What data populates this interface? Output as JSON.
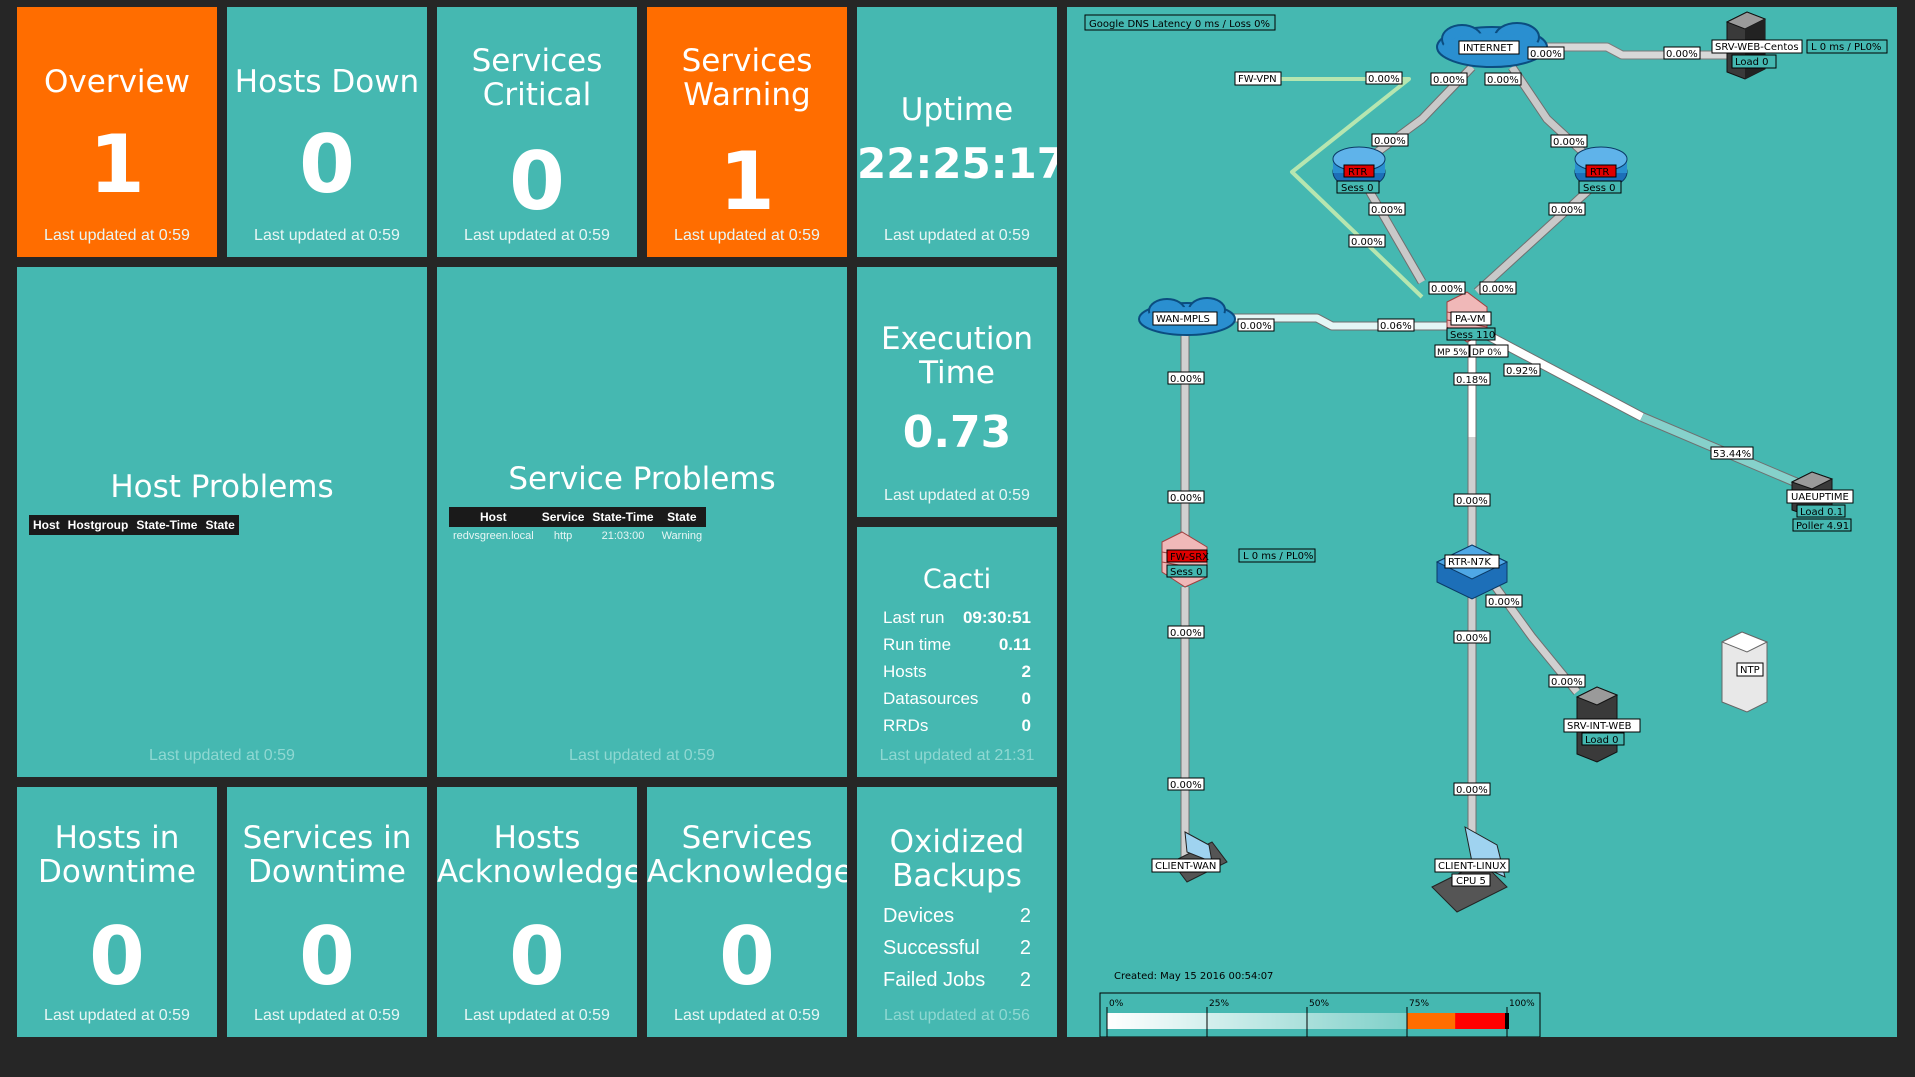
{
  "tiles": {
    "overview": {
      "title": "Overview",
      "value": "1",
      "updated": "Last updated at 0:59"
    },
    "hosts_down": {
      "title": "Hosts Down",
      "value": "0",
      "updated": "Last updated at 0:59"
    },
    "services_critical": {
      "title1": "Services",
      "title2": "Critical",
      "value": "0",
      "updated": "Last updated at 0:59"
    },
    "services_warning": {
      "title1": "Services",
      "title2": "Warning",
      "value": "1",
      "updated": "Last updated at 0:59"
    },
    "uptime": {
      "title": "Uptime",
      "value": "22:25:17",
      "updated": "Last updated at 0:59"
    },
    "host_problems": {
      "title": "Host Problems",
      "headers": [
        "Host",
        "Hostgroup",
        "State-Time",
        "State"
      ],
      "updated": "Last updated at 0:59"
    },
    "service_problems": {
      "title": "Service Problems",
      "headers": [
        "Host",
        "Service",
        "State-Time",
        "State"
      ],
      "rows": [
        [
          "redvsgreen.local",
          "http",
          "21:03:00",
          "Warning"
        ]
      ],
      "updated": "Last updated at 0:59"
    },
    "execution_time": {
      "title1": "Execution",
      "title2": "Time",
      "value": "0.73",
      "updated": "Last updated at 0:59"
    },
    "cacti": {
      "title": "Cacti",
      "rows": [
        [
          "Last run",
          "09:30:51"
        ],
        [
          "Run time",
          "0.11"
        ],
        [
          "Hosts",
          "2"
        ],
        [
          "Datasources",
          "0"
        ],
        [
          "RRDs",
          "0"
        ]
      ],
      "updated": "Last updated at 21:31"
    },
    "hosts_in_downtime": {
      "title1": "Hosts in",
      "title2": "Downtime",
      "value": "0",
      "updated": "Last updated at 0:59"
    },
    "services_in_downtime": {
      "title1": "Services in",
      "title2": "Downtime",
      "value": "0",
      "updated": "Last updated at 0:59"
    },
    "hosts_acknowledged": {
      "title1": "Hosts",
      "title2": "Acknowledged",
      "value": "0",
      "updated": "Last updated at 0:59"
    },
    "services_acknowledged": {
      "title1": "Services",
      "title2": "Acknowledged",
      "value": "0",
      "updated": "Last updated at 0:59"
    },
    "oxidized": {
      "title1": "Oxidized",
      "title2": "Backups",
      "rows": [
        [
          "Devices",
          "2"
        ],
        [
          "Successful",
          "2"
        ],
        [
          "Failed Jobs",
          "2"
        ]
      ],
      "updated": "Last updated at 0:56"
    }
  },
  "weathermap": {
    "title_box": "Google DNS Latency 0 ms / Loss 0%",
    "created": "Created: May 15 2016 00:54:07",
    "nodes": {
      "internet": "INTERNET",
      "srv_web_centos": "SRV-WEB-Centos",
      "srv_web_centos_load": "Load 0",
      "srv_web_centos_latency": "L 0 ms / PL0%",
      "fw_vpn": "FW-VPN",
      "rtr1": "RTR",
      "rtr1_sess": "Sess 0",
      "rtr2": "RTR",
      "rtr2_sess": "Sess 0",
      "wan_mpls": "WAN-MPLS",
      "pa_vm": "PA-VM",
      "pa_vm_sess": "Sess 110",
      "pa_vm_mp": "MP 5%",
      "pa_vm_dp": "DP 0%",
      "uaeuptime": "UAEUPTIME",
      "uaeuptime_load": "Load 0.1",
      "uaeuptime_poller": "Poller 4.91",
      "fw_srx": "FW-SRX",
      "fw_srx_sess": "Sess 0",
      "fw_srx_latency": "L 0 ms / PL0%",
      "rtr_n7k": "RTR-N7K",
      "srv_int_web": "SRV-INT-WEB",
      "srv_int_web_load": "Load 0",
      "ntp": "NTP",
      "client_wan": "CLIENT-WAN",
      "client_linux": "CLIENT-LINUX",
      "client_linux_cpu": "CPU 5"
    },
    "link_labels": {
      "inet_centos_a": "0.00%",
      "inet_centos_b": "0.00%",
      "vpn": "0.00%",
      "inet_rtr1_a": "0.00%",
      "inet_rtr1_b": "0.00%",
      "inet_rtr2_a": "0.00%",
      "inet_rtr2_b": "0.00%",
      "rtr1_pa_a": "0.00%",
      "rtr1_pa_b": "0.00%",
      "rtr2_pa_a": "0.00%",
      "rtr2_pa_b": "0.00%",
      "vpn_pa": "0.00%",
      "wan_pa_a": "0.00%",
      "wan_pa_b": "0.06%",
      "pa_uae_a": "0.92%",
      "pa_uae_b": "53.44%",
      "pa_n7k_a": "0.18%",
      "pa_n7k_b": "0.00%",
      "wan_srx_a": "0.00%",
      "wan_srx_b": "0.00%",
      "srx_client_a": "0.00%",
      "srx_client_b": "0.00%",
      "n7k_int_a": "0.00%",
      "n7k_int_b": "0.00%",
      "n7k_client_a": "0.00%",
      "n7k_client_b": "0.00%"
    },
    "legend_ticks": [
      "0%",
      "25%",
      "50%",
      "75%",
      "100%"
    ]
  },
  "colors": {
    "teal": "#45b8b1",
    "alert": "#ff6d00",
    "background": "#262626"
  }
}
